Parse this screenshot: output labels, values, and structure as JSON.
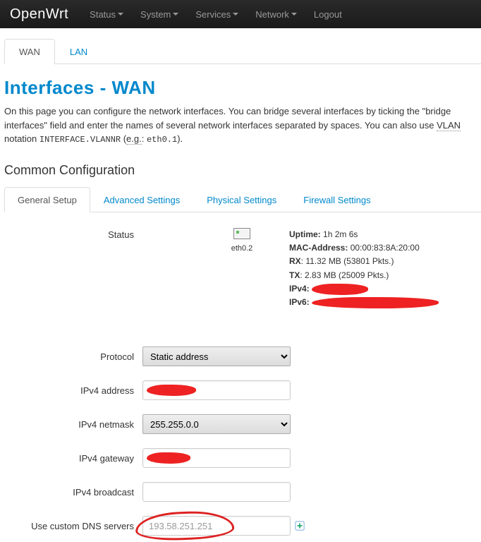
{
  "nav": {
    "brand": "OpenWrt",
    "items": [
      {
        "label": "Status",
        "caret": true
      },
      {
        "label": "System",
        "caret": true
      },
      {
        "label": "Services",
        "caret": true
      },
      {
        "label": "Network",
        "caret": true
      },
      {
        "label": "Logout",
        "caret": false
      }
    ]
  },
  "toptabs": {
    "wan": "WAN",
    "lan": "LAN"
  },
  "page": {
    "title": "Interfaces - WAN",
    "desc_a": "On this page you can configure the network interfaces. You can bridge several interfaces by ticking the \"bridge interfaces\" field and enter the names of several network interfaces separated by spaces. You can also use ",
    "desc_vlan": "VLAN",
    "desc_b": " notation ",
    "desc_int": "INTERFACE.VLANNR",
    "desc_c": " (",
    "desc_eg": "e.g.",
    "desc_d": ": ",
    "desc_eth": "eth0.1",
    "desc_e": ")."
  },
  "section": "Common Configuration",
  "innertabs": {
    "general": "General Setup",
    "advanced": "Advanced Settings",
    "physical": "Physical Settings",
    "firewall": "Firewall Settings"
  },
  "status": {
    "label": "Status",
    "iface": "eth0.2",
    "uptime_k": "Uptime:",
    "uptime_v": "1h 2m 6s",
    "mac_k": "MAC-Address:",
    "mac_v": "00:00:83:8A:20:00",
    "rx_k": "RX",
    "rx_v": ": 11.32 MB (53801 Pkts.)",
    "tx_k": "TX",
    "tx_v": ": 2.83 MB (25009 Pkts.)",
    "ipv4_k": "IPv4:",
    "ipv6_k": "IPv6:"
  },
  "form": {
    "protocol": {
      "label": "Protocol",
      "value": "Static address"
    },
    "ipv4addr": {
      "label": "IPv4 address",
      "value": ""
    },
    "ipv4mask": {
      "label": "IPv4 netmask",
      "value": "255.255.0.0"
    },
    "ipv4gw": {
      "label": "IPv4 gateway",
      "value": ""
    },
    "ipv4bc": {
      "label": "IPv4 broadcast",
      "value": ""
    },
    "dns": {
      "label": "Use custom DNS servers",
      "value": "193.58.251.251"
    }
  }
}
